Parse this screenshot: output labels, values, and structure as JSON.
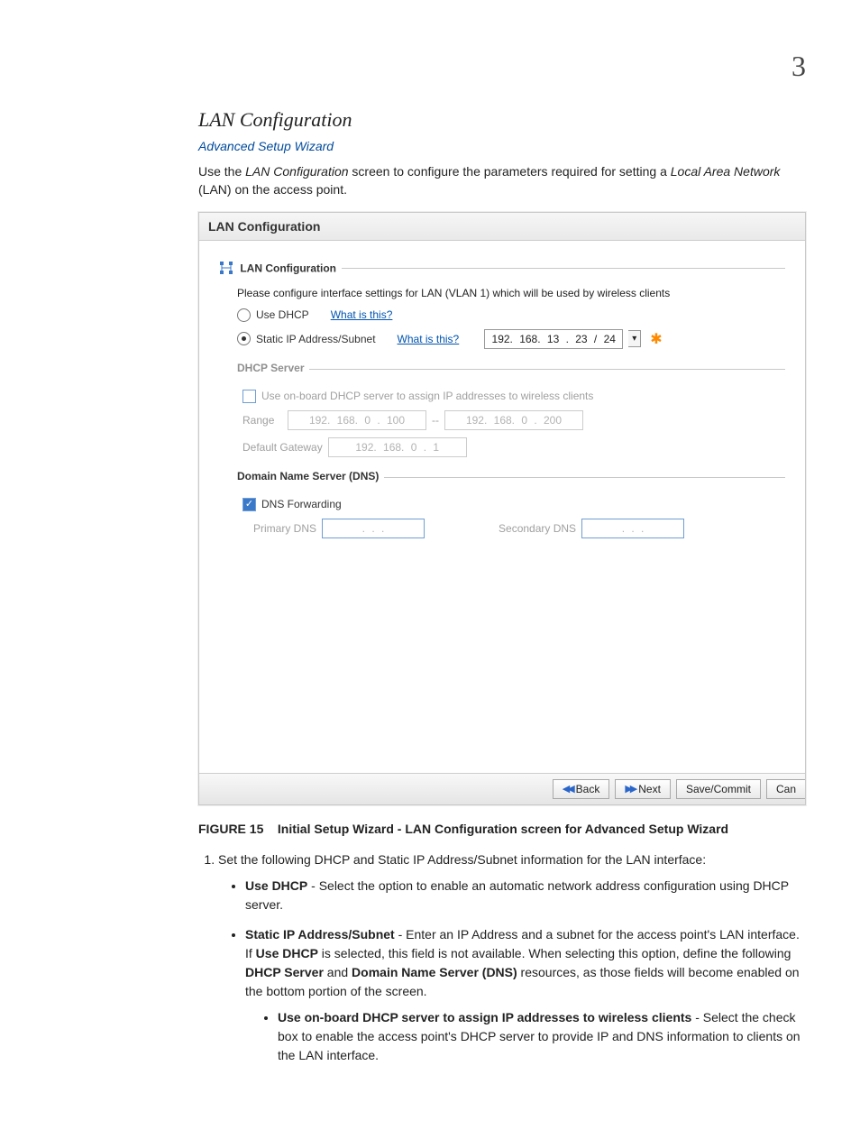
{
  "page_number": "3",
  "section_title": "LAN Configuration",
  "wizard_link": "Advanced Setup Wizard",
  "intro_pre": "Use the ",
  "intro_em1": "LAN Configuration",
  "intro_mid": " screen to configure the parameters required for setting a ",
  "intro_em2": "Local Area Network",
  "intro_post": " (LAN) on the access point.",
  "panel": {
    "title": "LAN Configuration",
    "fs_title": "LAN Configuration",
    "instr": "Please configure interface settings for LAN (VLAN 1) which will be used by wireless clients",
    "use_dhcp": "Use DHCP",
    "what_is_this": "What is this?",
    "static_ip_label": "Static IP Address/Subnet",
    "ip_value": "192. 168. 13 . 23 / 24",
    "dropdown_glyph": "▾",
    "dhcp_server_title": "DHCP Server",
    "dhcp_cb_label": "Use on-board DHCP server to assign IP addresses to wireless clients",
    "range_label": "Range",
    "range_from": "192. 168.  0 . 100",
    "range_sep": "--",
    "range_to": "192. 168.  0 . 200",
    "gateway_label": "Default Gateway",
    "gateway_val": "192. 168.  0  .  1",
    "dns_title": "Domain Name Server (DNS)",
    "dns_fwd": "DNS Forwarding",
    "primary_dns": "Primary DNS",
    "primary_dns_val": ".      .      .",
    "secondary_dns": "Secondary DNS",
    "secondary_dns_val": ".      .      .",
    "back": "Back",
    "next": "Next",
    "save": "Save/Commit",
    "cancel": "Can"
  },
  "figure_label": "FIGURE 15",
  "figure_caption": "Initial Setup Wizard - LAN Configuration screen for Advanced Setup Wizard",
  "step1": "Set the following DHCP and Static IP Address/Subnet information for the LAN interface:",
  "b1_lead": "Use DHCP",
  "b1_text": " - Select the option to enable an automatic network address configuration using DHCP server.",
  "b2_lead": "Static IP Address/Subnet",
  "b2_pre": " - Enter an IP Address and a subnet for the access point's LAN interface. If ",
  "b2_bold1": "Use DHCP",
  "b2_mid1": " is selected, this field is not available. When selecting this option, define the following ",
  "b2_bold2": "DHCP Server",
  "b2_mid2": " and ",
  "b2_bold3": "Domain Name Server (DNS)",
  "b2_post": " resources, as those fields will become enabled on the bottom portion of the screen.",
  "b3_lead": "Use on-board DHCP server to assign IP addresses to wireless clients",
  "b3_text": " - Select the check box to enable the access point's DHCP server to provide IP and DNS information to clients on the LAN interface."
}
